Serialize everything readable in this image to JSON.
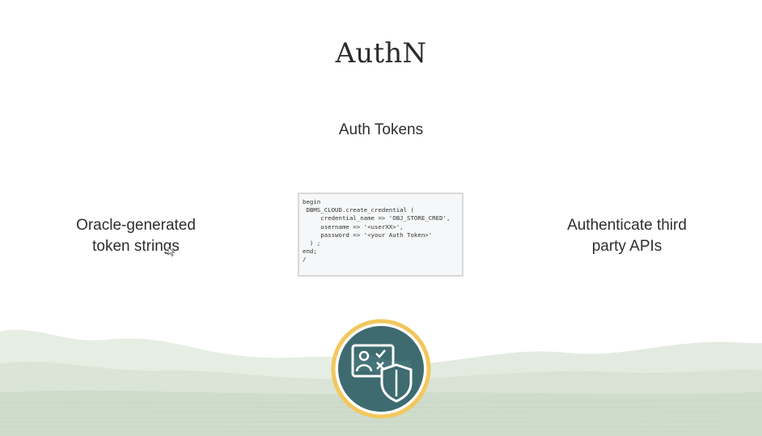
{
  "slide": {
    "title": "AuthN",
    "subtitle": "Auth Tokens",
    "left_text": [
      "Oracle-generated",
      "token strings"
    ],
    "right_text": [
      "Authenticate third",
      "party APIs"
    ],
    "code_lines": [
      "begin",
      " DBMS_CLOUD.create_credential (",
      "     credential_name => 'OBJ_STORE_CRED',",
      "     username => '<userXX>',",
      "     password => '<your Auth Token>'",
      "  ) ;",
      "end;",
      "/"
    ],
    "badge_icon": "credential-shield-icon"
  },
  "colors": {
    "badge_ring": "#f2c75c",
    "badge_fill": "#3e6b70",
    "landscape": "#dfe8dc"
  }
}
